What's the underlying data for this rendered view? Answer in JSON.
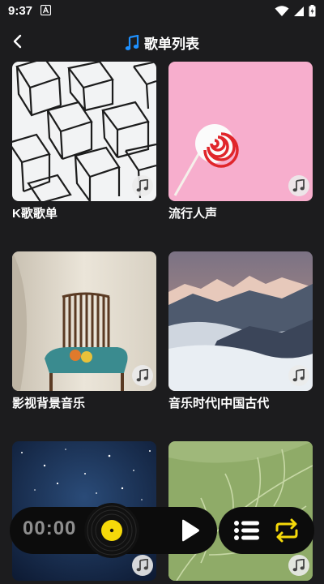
{
  "status": {
    "time": "9:37"
  },
  "header": {
    "title": "歌单列表"
  },
  "playlists": [
    {
      "title": "K歌歌单"
    },
    {
      "title": "流行人声"
    },
    {
      "title": "影视背景音乐"
    },
    {
      "title": "音乐时代|中国古代"
    },
    {
      "title": ""
    },
    {
      "title": ""
    }
  ],
  "player": {
    "time": "00:00"
  },
  "colors": {
    "accent": "#f5d90a",
    "background": "#1c1c1e",
    "pink": "#f7aecd"
  }
}
